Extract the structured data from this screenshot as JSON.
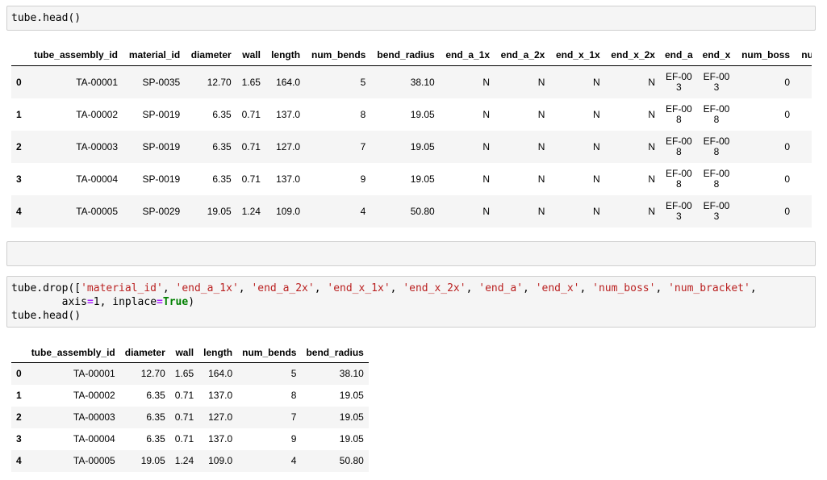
{
  "cell1": {
    "code": "tube.head()"
  },
  "cell3": {
    "line1_prefix": "tube.drop([",
    "drop_columns": [
      "'material_id'",
      "'end_a_1x'",
      "'end_a_2x'",
      "'end_x_1x'",
      "'end_x_2x'",
      "'end_a'",
      "'end_x'",
      "'num_boss'",
      "'num_bracket'"
    ],
    "line1_suffix": ",",
    "line2_indent": "        ",
    "axis_kw": "axis",
    "eq": "=",
    "axis_val": "1",
    "sep": ", ",
    "inplace_kw": "inplace",
    "inplace_val": "True",
    "line2_end": ")",
    "line3": "tube.head()"
  },
  "table1": {
    "columns": [
      "",
      "tube_assembly_id",
      "material_id",
      "diameter",
      "wall",
      "length",
      "num_bends",
      "bend_radius",
      "end_a_1x",
      "end_a_2x",
      "end_x_1x",
      "end_x_2x",
      "end_a",
      "end_x",
      "num_boss",
      "num_bracket"
    ],
    "rows": [
      [
        "0",
        "TA-00001",
        "SP-0035",
        "12.70",
        "1.65",
        "164.0",
        "5",
        "38.10",
        "N",
        "N",
        "N",
        "N",
        "EF-003",
        "EF-003",
        "0",
        ""
      ],
      [
        "1",
        "TA-00002",
        "SP-0019",
        "6.35",
        "0.71",
        "137.0",
        "8",
        "19.05",
        "N",
        "N",
        "N",
        "N",
        "EF-008",
        "EF-008",
        "0",
        ""
      ],
      [
        "2",
        "TA-00003",
        "SP-0019",
        "6.35",
        "0.71",
        "127.0",
        "7",
        "19.05",
        "N",
        "N",
        "N",
        "N",
        "EF-008",
        "EF-008",
        "0",
        ""
      ],
      [
        "3",
        "TA-00004",
        "SP-0019",
        "6.35",
        "0.71",
        "137.0",
        "9",
        "19.05",
        "N",
        "N",
        "N",
        "N",
        "EF-008",
        "EF-008",
        "0",
        ""
      ],
      [
        "4",
        "TA-00005",
        "SP-0029",
        "19.05",
        "1.24",
        "109.0",
        "4",
        "50.80",
        "N",
        "N",
        "N",
        "N",
        "EF-003",
        "EF-003",
        "0",
        ""
      ]
    ]
  },
  "table2": {
    "columns": [
      "",
      "tube_assembly_id",
      "diameter",
      "wall",
      "length",
      "num_bends",
      "bend_radius"
    ],
    "rows": [
      [
        "0",
        "TA-00001",
        "12.70",
        "1.65",
        "164.0",
        "5",
        "38.10"
      ],
      [
        "1",
        "TA-00002",
        "6.35",
        "0.71",
        "137.0",
        "8",
        "19.05"
      ],
      [
        "2",
        "TA-00003",
        "6.35",
        "0.71",
        "127.0",
        "7",
        "19.05"
      ],
      [
        "3",
        "TA-00004",
        "6.35",
        "0.71",
        "137.0",
        "9",
        "19.05"
      ],
      [
        "4",
        "TA-00005",
        "19.05",
        "1.24",
        "109.0",
        "4",
        "50.80"
      ]
    ]
  }
}
